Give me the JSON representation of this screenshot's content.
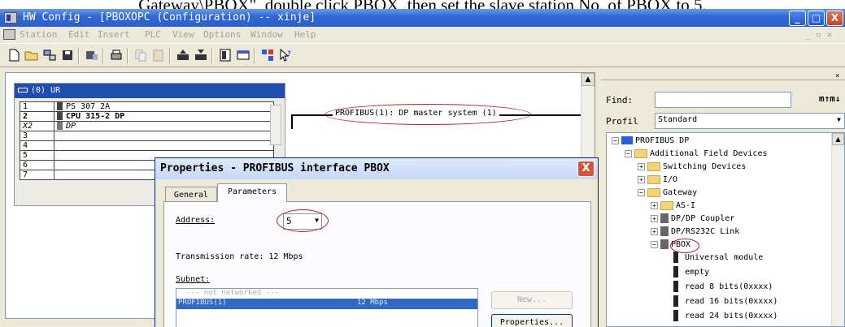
{
  "caption": "Gateway\\PBOX\", double click PBOX, then set the slave station No. of PBOX to 5.",
  "window": {
    "title": "HW Config - [PBOXOPC (Configuration) -- xinje]",
    "min": "_",
    "max": "□",
    "close": "X"
  },
  "menu": [
    "Station",
    "Edit",
    "Insert",
    "PLC",
    "View",
    "Options",
    "Window",
    "Help"
  ],
  "menu_right": "_ ▫ ×",
  "station": {
    "rack_title": "(0) UR",
    "slots": [
      {
        "n": "1",
        "module": "PS 307 2A"
      },
      {
        "n": "2",
        "module": "CPU 315-2 DP"
      },
      {
        "n": "X2",
        "module": "DP"
      },
      {
        "n": "3",
        "module": ""
      },
      {
        "n": "4",
        "module": ""
      },
      {
        "n": "5",
        "module": ""
      },
      {
        "n": "6",
        "module": ""
      },
      {
        "n": "7",
        "module": ""
      }
    ],
    "dp_label": "PROFIBUS(1): DP master system (1)"
  },
  "catalog": {
    "find_label": "Find:",
    "find_value": "",
    "profile_label": "Profil",
    "profile_value": "Standard",
    "tree": [
      {
        "label": "PROFIBUS DP",
        "level": 0,
        "expander": "−",
        "icon": "bus"
      },
      {
        "label": "Additional Field Devices",
        "level": 1,
        "expander": "−",
        "icon": "folder"
      },
      {
        "label": "Switching Devices",
        "level": 2,
        "expander": "+",
        "icon": "folder"
      },
      {
        "label": "I/O",
        "level": 2,
        "expander": "+",
        "icon": "folder"
      },
      {
        "label": "Gateway",
        "level": 2,
        "expander": "−",
        "icon": "folder"
      },
      {
        "label": "AS-I",
        "level": 3,
        "expander": "+",
        "icon": "folder"
      },
      {
        "label": "DP/DP Coupler",
        "level": 3,
        "expander": "+",
        "icon": "device"
      },
      {
        "label": "DP/RS232C Link",
        "level": 3,
        "expander": "+",
        "icon": "device"
      },
      {
        "label": "PBOX",
        "level": 3,
        "expander": "−",
        "icon": "device"
      },
      {
        "label": "Universal module",
        "level": 4,
        "expander": "",
        "icon": "module"
      },
      {
        "label": "empty",
        "level": 4,
        "expander": "",
        "icon": "module"
      },
      {
        "label": "read 8 bits(0xxxx)",
        "level": 4,
        "expander": "",
        "icon": "module"
      },
      {
        "label": "read 16 bits(0xxxx)",
        "level": 4,
        "expander": "",
        "icon": "module"
      },
      {
        "label": "read 24 bits(0xxxx)",
        "level": 4,
        "expander": "",
        "icon": "module"
      }
    ]
  },
  "dialog": {
    "title": "Properties - PROFIBUS interface  PBOX",
    "close": "X",
    "tabs": [
      "General",
      "Parameters"
    ],
    "address_label": "Address:",
    "address_value": "5",
    "transmission": "Transmission rate: 12 Mbps",
    "subnet_label": "Subnet:",
    "subnet_items": [
      {
        "name": "--- not networked ---",
        "rate": ""
      },
      {
        "name": "PROFIBUS(1)",
        "rate": "12 Mbps"
      }
    ],
    "new_button": "New...",
    "properties_button": "Properties..."
  },
  "colors": {
    "title_blue": "#2b5fcf",
    "selection": "#316ac5",
    "highlight_ellipse": "#b02020"
  }
}
